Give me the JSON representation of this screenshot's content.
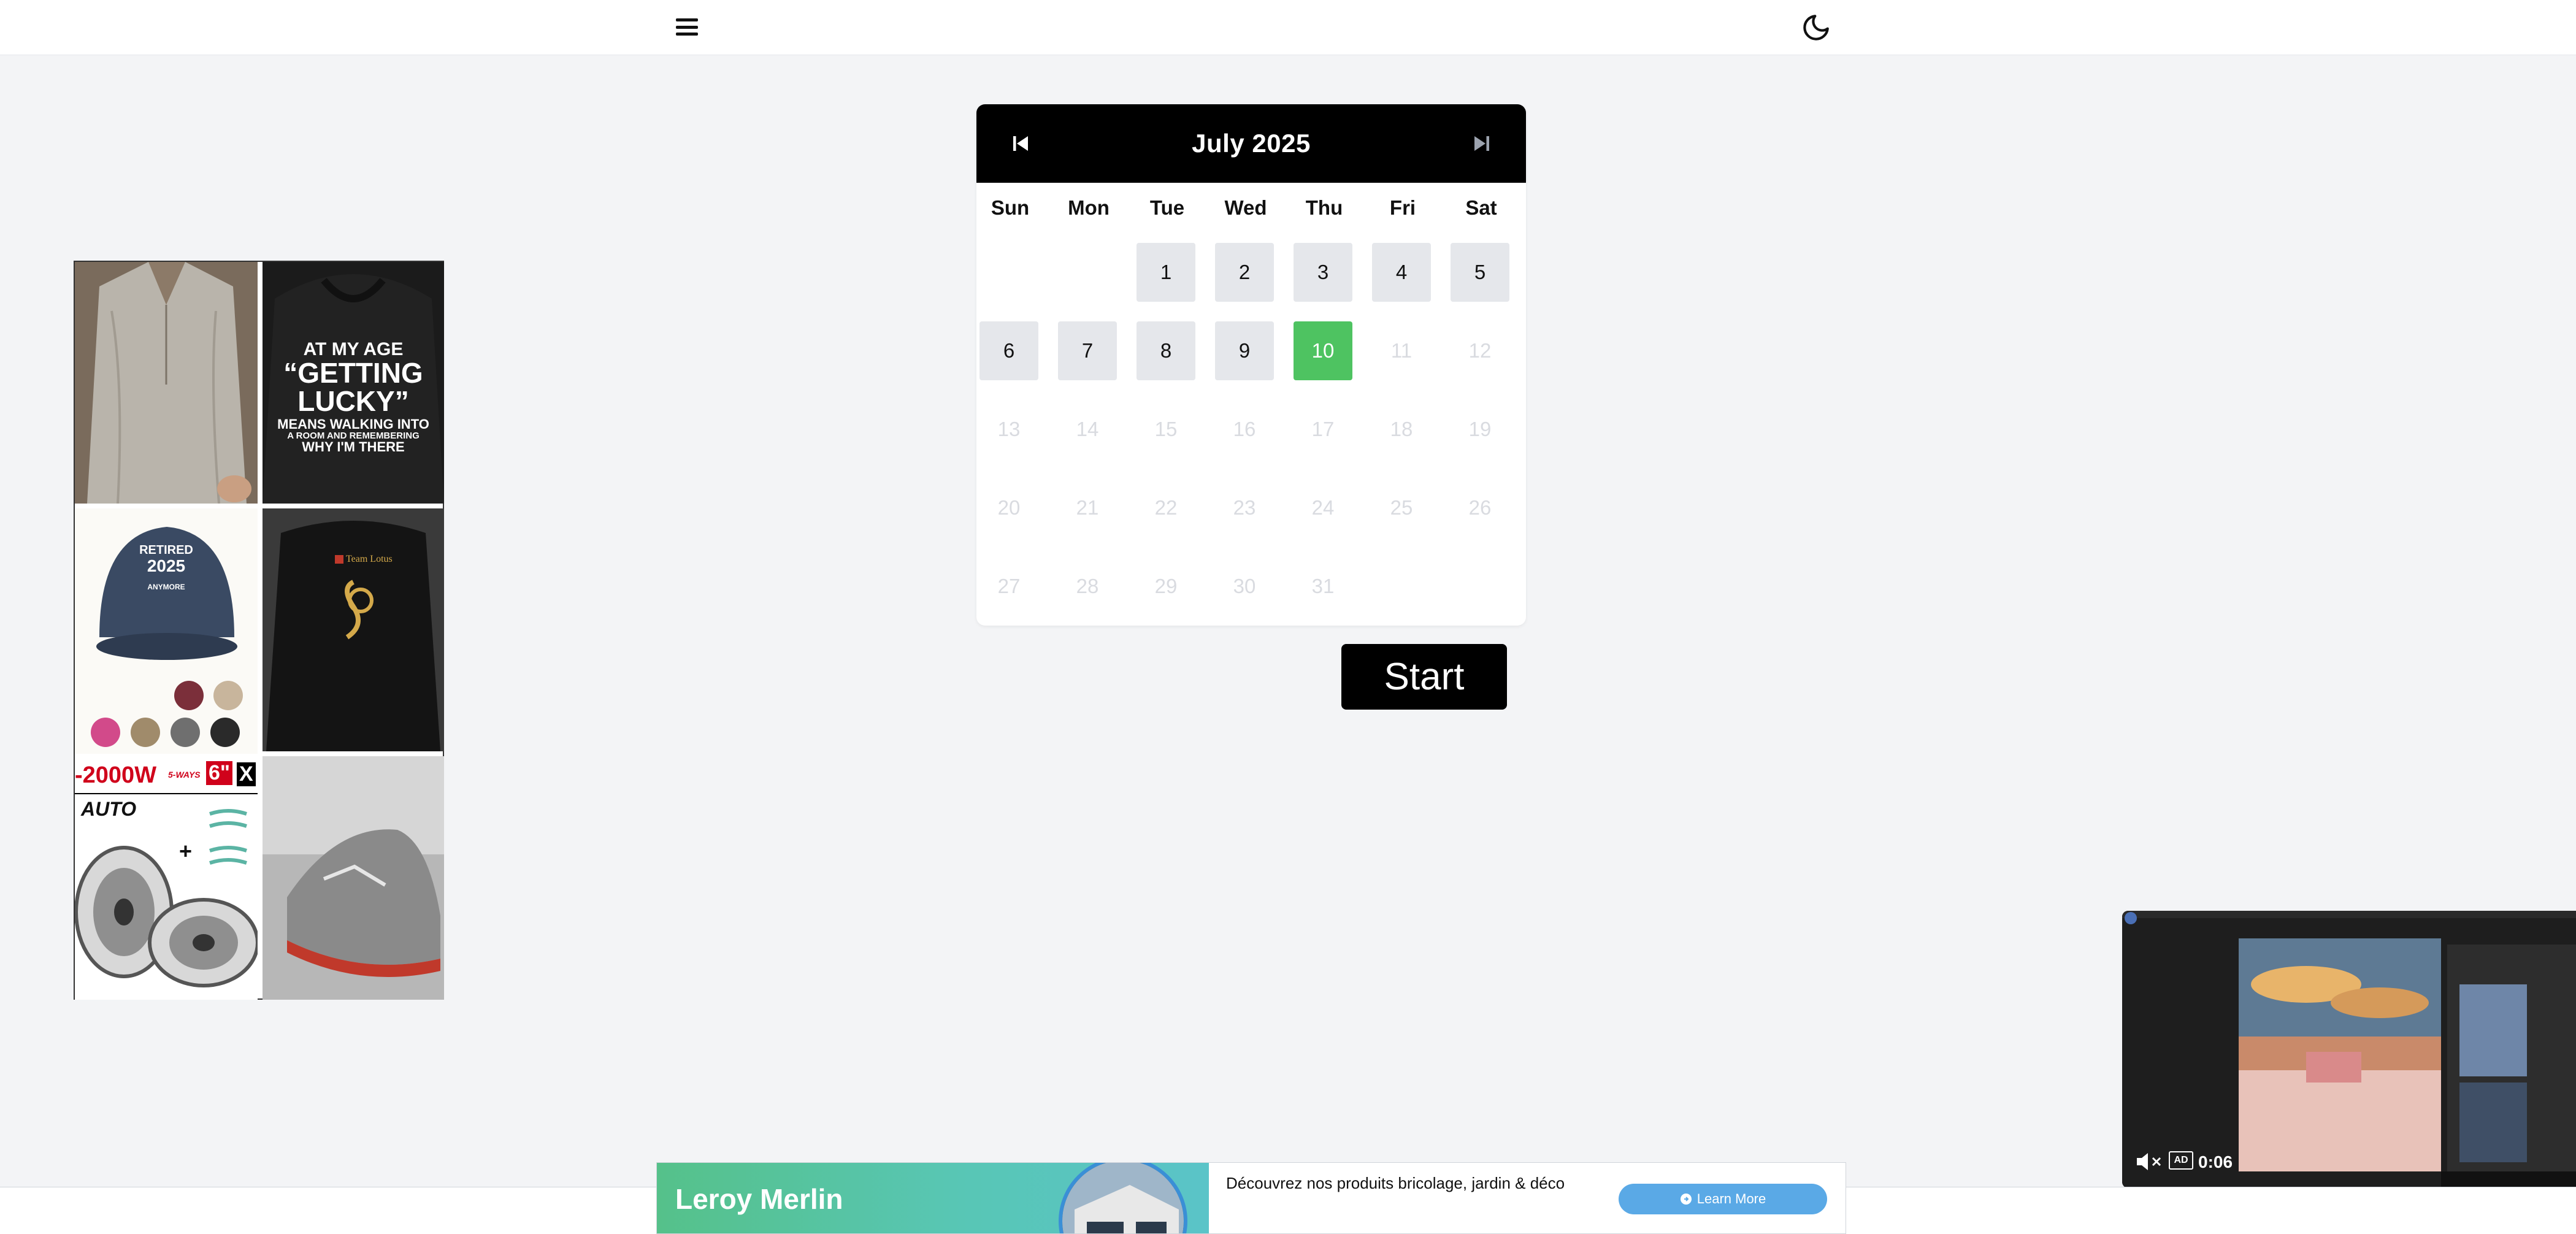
{
  "header": {
    "menu_icon": "hamburger-menu-icon",
    "theme_icon": "moon-icon"
  },
  "calendar": {
    "title": "July 2025",
    "prev_icon": "skip-back-icon",
    "next_icon": "skip-forward-icon",
    "weekdays": [
      "Sun",
      "Mon",
      "Tue",
      "Wed",
      "Thu",
      "Fri",
      "Sat"
    ],
    "days": [
      "1",
      "2",
      "3",
      "4",
      "5",
      "6",
      "7",
      "8",
      "9",
      "10",
      "11",
      "12",
      "13",
      "14",
      "15",
      "16",
      "17",
      "18",
      "19",
      "20",
      "21",
      "22",
      "23",
      "24",
      "25",
      "26",
      "27",
      "28",
      "29",
      "30",
      "31"
    ],
    "selected_day": "10",
    "colors": {
      "today": "#4ec361",
      "active": "#e5e7eb",
      "disabled": "#d9dbe0"
    }
  },
  "start_button": {
    "label": "Start"
  },
  "ad_grid": {
    "hoodie_text": [
      "AT MY AGE",
      "“GETTING",
      "LUCKY”",
      "MEANS WALKING INTO",
      "A ROOM AND REMEMBERING",
      "WHY I'M THERE"
    ],
    "cap_text": [
      "RETIRED",
      "2025",
      "ANYMORE"
    ],
    "jacket_text": "Team Lotus",
    "speaker_text": [
      "-2000W",
      "5-WAYS",
      "6\"",
      "X",
      "AUTO",
      "+"
    ]
  },
  "video_ad": {
    "time": "0:06",
    "badge": "AD",
    "mute_icon": "muted-speaker-icon"
  },
  "banner": {
    "brand": "Leroy Merlin",
    "text": "Découvrez nos produits bricolage, jardin & déco",
    "cta": "Learn More"
  }
}
